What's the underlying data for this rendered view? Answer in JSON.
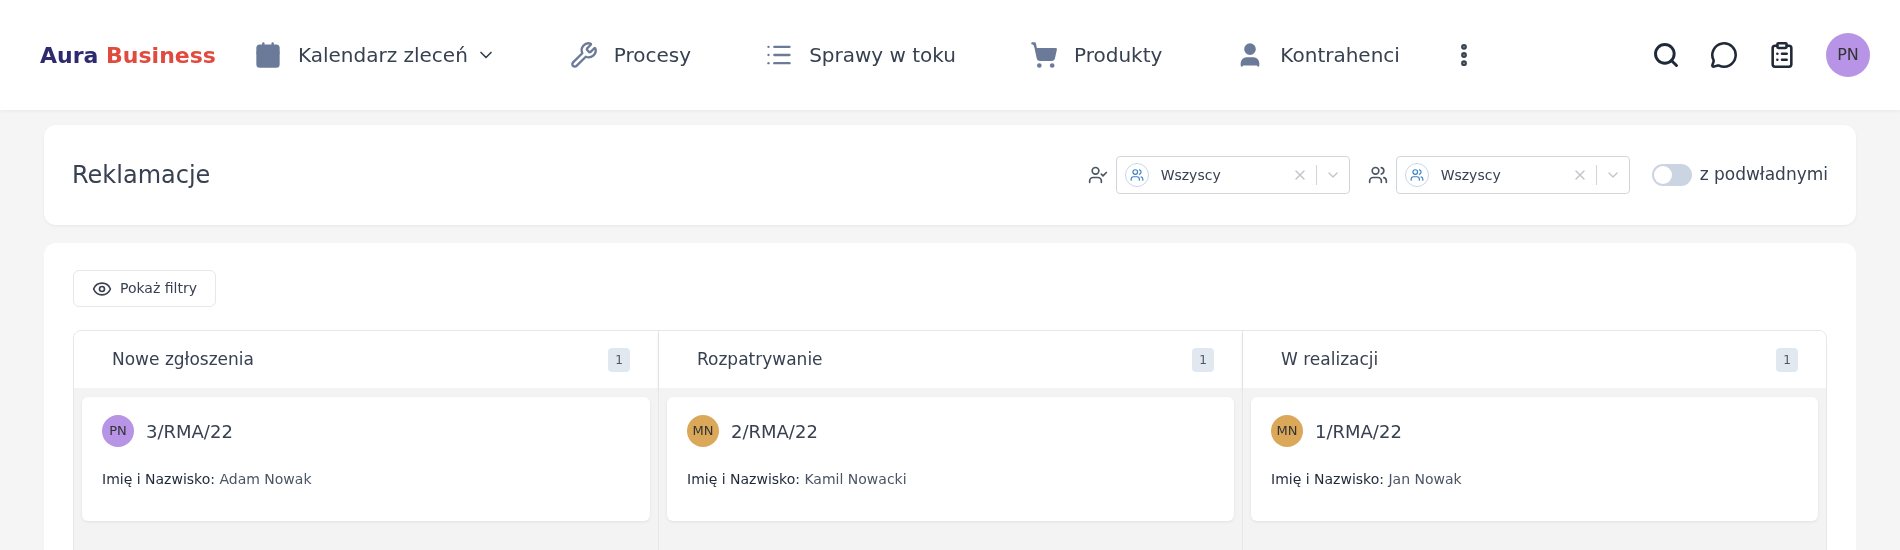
{
  "brand": {
    "first": "Aura",
    "second": "Business"
  },
  "nav": [
    {
      "label": "Kalendarz zleceń",
      "dropdown": true
    },
    {
      "label": "Procesy",
      "dropdown": false
    },
    {
      "label": "Sprawy w toku",
      "dropdown": false
    },
    {
      "label": "Produkty",
      "dropdown": false
    },
    {
      "label": "Kontrahenci",
      "dropdown": false
    }
  ],
  "user_avatar": {
    "initials": "PN",
    "color": "#b794e6"
  },
  "page": {
    "title": "Reklamacje",
    "filters": [
      {
        "value": "Wszyscy"
      },
      {
        "value": "Wszyscy"
      }
    ],
    "subordinates": {
      "label": "z podwładnymi",
      "on": false
    }
  },
  "show_filters_button": "Pokaż filtry",
  "columns": [
    {
      "title": "Nowe zgłoszenia",
      "count": "1",
      "cards": [
        {
          "number": "3/RMA/22",
          "initials": "PN",
          "color": "#b794e6",
          "field_label": "Imię i Nazwisko:",
          "field_value": "Adam Nowak"
        }
      ]
    },
    {
      "title": "Rozpatrywanie",
      "count": "1",
      "cards": [
        {
          "number": "2/RMA/22",
          "initials": "MN",
          "color": "#dba85a",
          "field_label": "Imię i Nazwisko:",
          "field_value": "Kamil Nowacki"
        }
      ]
    },
    {
      "title": "W realizacji",
      "count": "1",
      "cards": [
        {
          "number": "1/RMA/22",
          "initials": "MN",
          "color": "#dba85a",
          "field_label": "Imię i Nazwisko:",
          "field_value": "Jan Nowak"
        }
      ]
    }
  ]
}
